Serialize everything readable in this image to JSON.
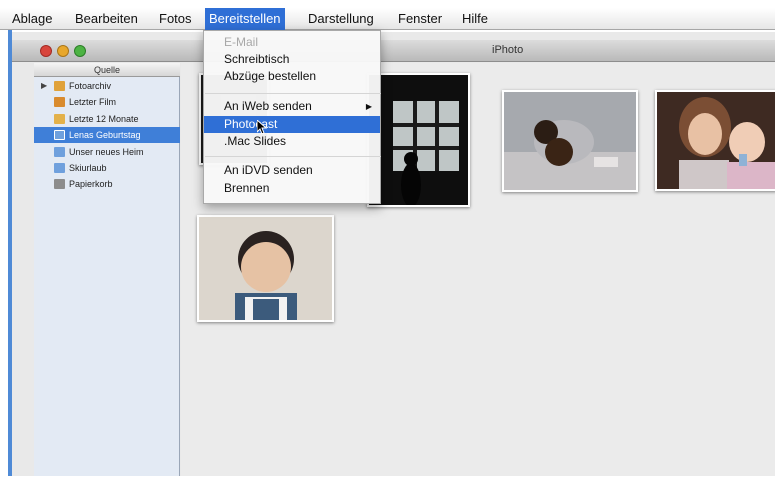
{
  "menubar": {
    "items": [
      "Ablage",
      "Bearbeiten",
      "Fotos",
      "Bereitstellen",
      "Darstellung",
      "Fenster",
      "Hilfe"
    ],
    "active": "Bereitstellen"
  },
  "window": {
    "title": "iPhoto"
  },
  "source_list": {
    "header": "Quelle",
    "items": [
      {
        "label": "Fotoarchiv",
        "icon": "library-icon",
        "color": "#e0a23a"
      },
      {
        "label": "Letzter Film",
        "icon": "film-icon",
        "color": "#d98b2e"
      },
      {
        "label": "Letzte 12 Monate",
        "icon": "calendar-icon",
        "color": "#e3b14a"
      },
      {
        "label": "Lenas Geburtstag",
        "icon": "album-icon",
        "color": "#6fa0dd"
      },
      {
        "label": "Unser neues Heim",
        "icon": "album-icon",
        "color": "#6fa0dd"
      },
      {
        "label": "Skiurlaub",
        "icon": "album-icon",
        "color": "#6fa0dd"
      },
      {
        "label": "Papierkorb",
        "icon": "trash-icon",
        "color": "#8c8c8c"
      }
    ],
    "selected": "Lenas Geburtstag"
  },
  "share_menu": {
    "items": [
      {
        "label": "E-Mail",
        "disabled": true
      },
      {
        "label": "Schreibtisch",
        "disabled": false
      },
      {
        "label": "Abzüge bestellen",
        "disabled": false
      },
      {
        "label": "An iWeb senden",
        "disabled": false,
        "submenu": true
      },
      {
        "label": "Photocast",
        "disabled": false,
        "highlighted": true
      },
      {
        "label": ".Mac Slides",
        "disabled": false
      },
      {
        "label": "An iDVD senden",
        "disabled": false
      },
      {
        "label": "Brennen",
        "disabled": false
      }
    ],
    "submenu_arrow": "▶"
  },
  "photos": [
    {
      "subject": "dark-photo"
    },
    {
      "subject": "window-silhouette-photo"
    },
    {
      "subject": "dog-on-couch-photo"
    },
    {
      "subject": "two-girls-photo"
    },
    {
      "subject": "baby-photo"
    }
  ],
  "colors": {
    "accent": "#2f6fd6",
    "selection": "#3f7fd8"
  }
}
